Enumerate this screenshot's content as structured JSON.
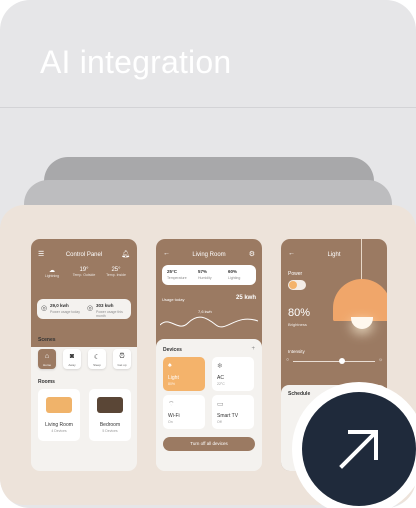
{
  "card": {
    "title": "AI integration"
  },
  "phone1": {
    "title": "Control Panel",
    "weather": [
      {
        "value": "",
        "label": "Lightning"
      },
      {
        "value": "19°",
        "label": "Temp. Outside"
      },
      {
        "value": "25°",
        "label": "Temp. Inside"
      }
    ],
    "power": [
      {
        "value": "29,0 kwh",
        "label": "Power usage today"
      },
      {
        "value": "303 kwh",
        "label": "Power usage this month"
      }
    ],
    "scenes_label": "Scenes",
    "scenes": [
      {
        "name": "Home",
        "active": true
      },
      {
        "name": "Away",
        "active": false
      },
      {
        "name": "Sleep",
        "active": false
      },
      {
        "name": "Get up",
        "active": false
      }
    ],
    "rooms_label": "Rooms",
    "rooms": [
      {
        "name": "Living Room",
        "sub": "4 Devices"
      },
      {
        "name": "Bedroom",
        "sub": "5 Devices"
      }
    ]
  },
  "phone2": {
    "title": "Living Room",
    "stats": [
      {
        "value": "25°C",
        "label": "Temperature"
      },
      {
        "value": "57%",
        "label": "Humidity"
      },
      {
        "value": "60%",
        "label": "Lighting"
      }
    ],
    "usage_label": "Usage today",
    "usage_value": "25 kwh",
    "usage_point": "7,6 kwh",
    "devices_label": "Devices",
    "devices": [
      {
        "name": "Light",
        "sub": "80%",
        "on": true
      },
      {
        "name": "AC",
        "sub": "22°C",
        "on": false
      },
      {
        "name": "Wi-Fi",
        "sub": "On",
        "on": false
      },
      {
        "name": "Smart TV",
        "sub": "Off",
        "on": false
      }
    ],
    "button": "Turn off all devices"
  },
  "phone3": {
    "title": "Light",
    "power_label": "Power",
    "brightness_value": "80%",
    "brightness_label": "Brightness",
    "intensity_label": "Intensity",
    "intensity": 0.6,
    "schedule_label": "Schedule"
  },
  "icons": {
    "cta": "arrow-up-right-icon"
  },
  "colors": {
    "accent_brown": "#9b7a62",
    "accent_orange": "#f4b36b",
    "cta_navy": "#1f2a3b"
  }
}
